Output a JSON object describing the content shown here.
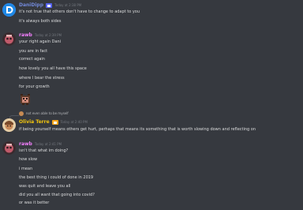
{
  "messages": [
    {
      "author": "DaniDipp",
      "author_color": "#7289da",
      "bot_badge": "bot-icon",
      "timestamp": "Today at 2:38 PM",
      "lines": [
        "it's not true that others don't have to change to adapt to you",
        "it's always both sides"
      ]
    },
    {
      "author": "rawb",
      "author_color": "#f47fff",
      "timestamp": "Today at 2:39 PM",
      "lines": [
        "your right again Dani",
        "you are in fact",
        "correct again",
        "how lovely you all have this space",
        "where I bear the stress",
        "for your growth"
      ],
      "sticker": "pixel-bear-sticker"
    },
    {
      "reply_text": "not even able to be myself",
      "author": "Olivia Terre",
      "author_color": "#f1c40f",
      "bot_badge": "verified-icon",
      "timestamp": "Today at 2:40 PM",
      "lines": [
        "if being yourself means others get hurt, perhaps that means its something that is worth slowing down and reflecting on"
      ]
    },
    {
      "author": "rawb",
      "author_color": "#f47fff",
      "timestamp": "Today at 2:41 PM",
      "lines": [
        "isn't that what im doing?",
        "how slow",
        "i mean",
        "the best thing i could of done in 2019",
        "was quit and leave you all",
        "did you all want that going into covid?",
        "or was it better"
      ]
    }
  ]
}
